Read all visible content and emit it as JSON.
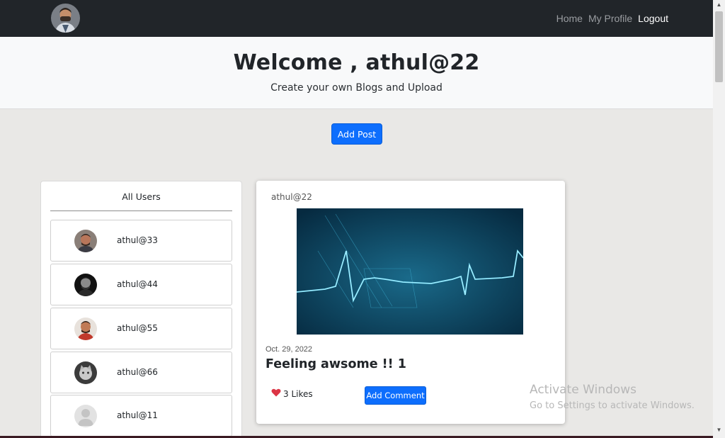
{
  "navbar": {
    "avatar_icon": "user-avatar-photo",
    "links": [
      {
        "label": "Home"
      },
      {
        "label": "My Profile"
      },
      {
        "label": "Logout"
      }
    ]
  },
  "hero": {
    "title": "Welcome , athul@22",
    "subtitle": "Create your own Blogs and Upload"
  },
  "add_post_label": "Add Post",
  "users": {
    "title": "All Users",
    "items": [
      {
        "name": "athul@33",
        "avatar": "profile-photo"
      },
      {
        "name": "athul@44",
        "avatar": "profile-photo"
      },
      {
        "name": "athul@55",
        "avatar": "profile-photo"
      },
      {
        "name": "athul@66",
        "avatar": "profile-photo"
      },
      {
        "name": "athul@11",
        "avatar": "default-avatar"
      }
    ]
  },
  "post": {
    "author": "athul@22",
    "image": "heartbeat-ecg-image",
    "date": "Oct. 29, 2022",
    "title": "Feeling awsome !! 1",
    "likes_label": "3 Likes",
    "comment_label": "Add Comment"
  },
  "watermark": {
    "title": "Activate Windows",
    "subtitle": "Go to Settings to activate Windows."
  },
  "colors": {
    "navbar": "#212529",
    "primary": "#0d6efd",
    "heart": "#dc3545",
    "background": "#e9e8e6"
  }
}
